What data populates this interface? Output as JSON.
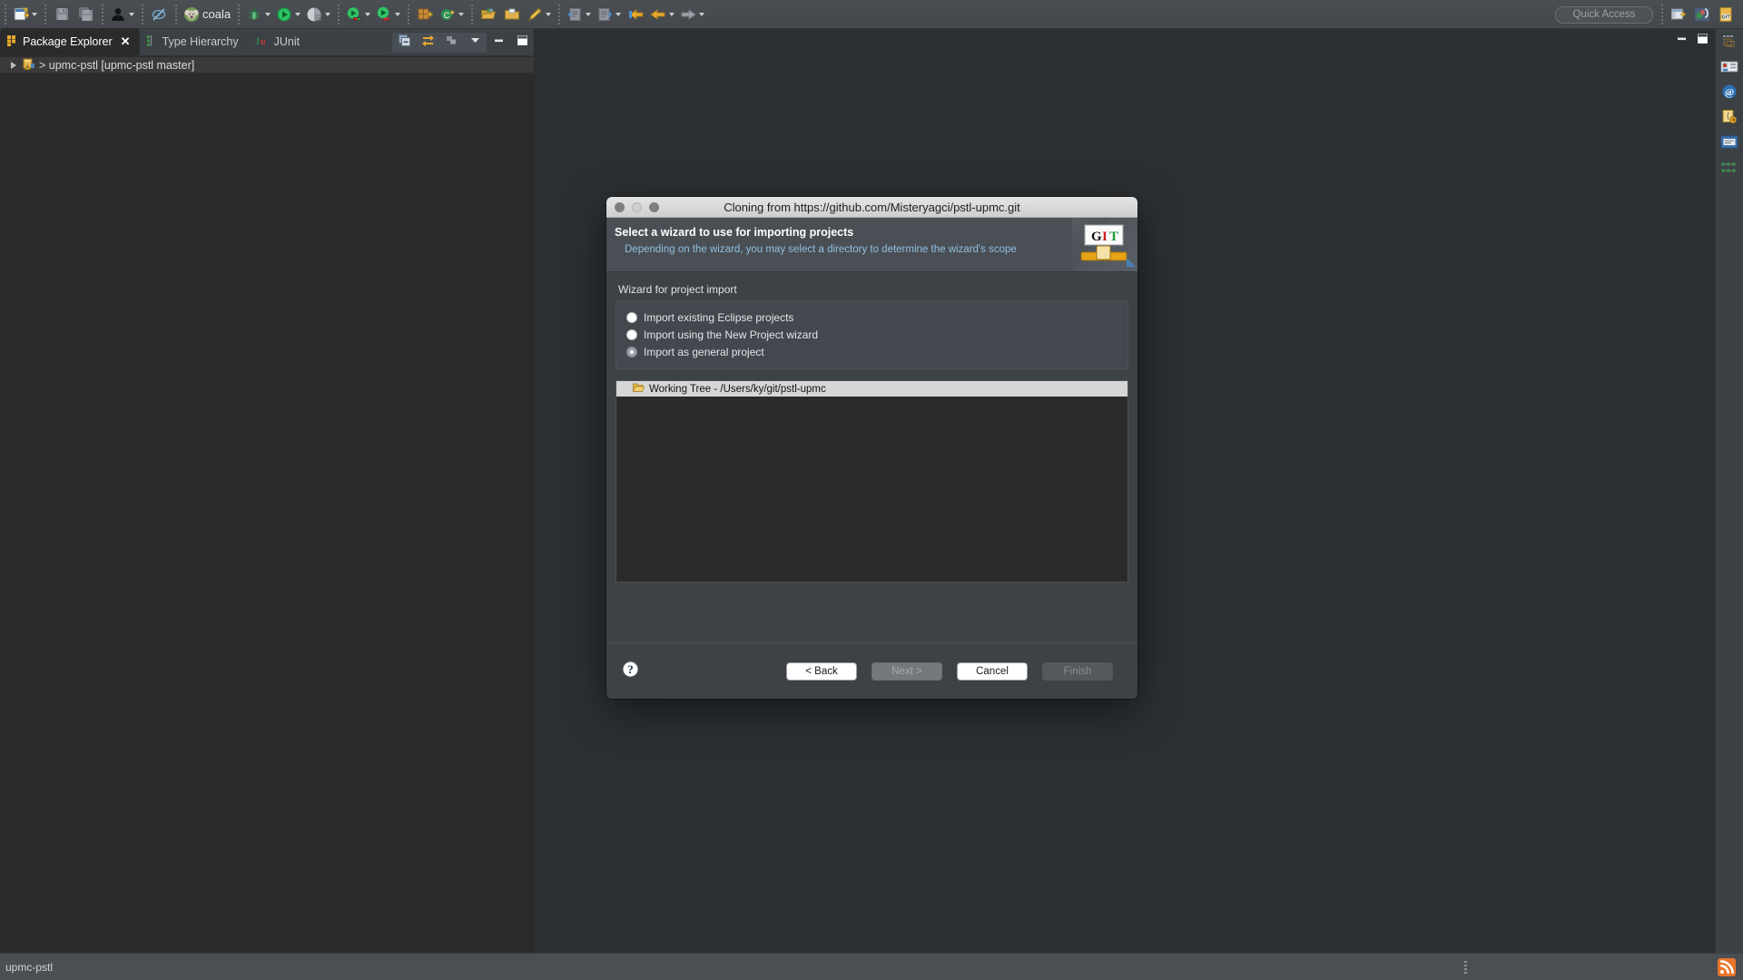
{
  "toolbar": {
    "items": [
      {
        "name": "new-wizard-button",
        "icon": "new-file-icon",
        "dropdown": true
      },
      {
        "name": "save-button",
        "icon": "save-disk-icon",
        "dropdown": false
      },
      {
        "name": "save-all-button",
        "icon": "save-all-icon",
        "dropdown": false
      },
      {
        "name": "person-button",
        "icon": "person-icon",
        "dropdown": true
      },
      {
        "name": "skip-breakpoints-button",
        "icon": "skip-breakpoints-icon",
        "dropdown": false
      },
      {
        "name": "coala-button",
        "icon": "coala-icon",
        "dropdown": false,
        "label": "coala"
      },
      {
        "name": "debug-button",
        "icon": "bug-icon",
        "dropdown": true
      },
      {
        "name": "run-button",
        "icon": "run-green-icon",
        "dropdown": true
      },
      {
        "name": "coverage-button",
        "icon": "coverage-icon",
        "dropdown": true
      },
      {
        "name": "run-external-tools-button",
        "icon": "run-tools-icon",
        "dropdown": true
      },
      {
        "name": "run-ant-button",
        "icon": "run-ant-icon",
        "dropdown": true
      },
      {
        "name": "new-java-package-button",
        "icon": "new-package-icon",
        "dropdown": false
      },
      {
        "name": "new-class-button",
        "icon": "new-class-icon",
        "dropdown": true
      },
      {
        "name": "open-type-button",
        "icon": "open-type-icon",
        "dropdown": false
      },
      {
        "name": "open-task-button",
        "icon": "open-folder-icon",
        "dropdown": false
      },
      {
        "name": "pencil-button",
        "icon": "pencil-icon",
        "dropdown": true
      },
      {
        "name": "previous-annotation-button",
        "icon": "prev-annotation-icon",
        "dropdown": true
      },
      {
        "name": "next-annotation-button",
        "icon": "next-annotation-icon",
        "dropdown": true
      },
      {
        "name": "last-edit-location-button",
        "icon": "last-edit-icon",
        "dropdown": false
      },
      {
        "name": "back-button",
        "icon": "arrow-left-icon",
        "dropdown": true
      },
      {
        "name": "forward-button",
        "icon": "arrow-right-icon",
        "dropdown": true
      }
    ],
    "coala_label": "coala",
    "quick_access_placeholder": "Quick Access",
    "perspective_buttons": [
      {
        "name": "open-perspective-button",
        "icon": "open-perspective-icon"
      },
      {
        "name": "java-perspective-button",
        "icon": "java-perspective-icon"
      },
      {
        "name": "git-perspective-button",
        "icon": "git-perspective-icon"
      }
    ]
  },
  "left_panel": {
    "tabs": [
      {
        "label": "Package Explorer",
        "icon": "package-explorer-icon",
        "active": true,
        "closable": true
      },
      {
        "label": "Type Hierarchy",
        "icon": "type-hierarchy-icon",
        "active": false,
        "closable": false
      },
      {
        "label": "JUnit",
        "icon": "junit-icon",
        "active": false,
        "closable": false
      }
    ],
    "close_label": "✕",
    "view_tools": [
      {
        "name": "collapse-all-button",
        "icon": "collapse-all-icon"
      },
      {
        "name": "link-with-editor-button",
        "icon": "link-editor-icon"
      },
      {
        "name": "focus-on-active-task-button",
        "icon": "focus-task-icon"
      },
      {
        "name": "view-menu-button",
        "icon": "chevron-down-icon"
      },
      {
        "name": "minimize-view-button",
        "icon": "minimize-icon"
      },
      {
        "name": "maximize-view-button",
        "icon": "maximize-icon"
      }
    ],
    "tree": [
      {
        "label": "> upmc-pstl [upmc-pstl master]",
        "icon": "java-project-warning-icon",
        "expandable": true,
        "selected": true
      }
    ]
  },
  "editor_area": {
    "controls": [
      {
        "name": "restore-editor-button",
        "icon": "minimize-icon"
      },
      {
        "name": "maximize-editor-button",
        "icon": "maximize-icon"
      }
    ]
  },
  "right_trim": {
    "items": [
      {
        "name": "restore-trim-button",
        "icon": "restore-icon"
      },
      {
        "name": "git-repositories-view-button",
        "icon": "git-repositories-icon"
      },
      {
        "name": "git-staging-view-button",
        "icon": "at-sign-icon"
      },
      {
        "name": "git-reflog-view-button",
        "icon": "reflog-icon"
      },
      {
        "name": "console-view-button",
        "icon": "console-icon"
      },
      {
        "name": "history-view-button",
        "icon": "history-graph-icon"
      }
    ]
  },
  "statusbar": {
    "text": "upmc-pstl",
    "rss_icon": "rss-icon"
  },
  "dialog": {
    "window_title": "Cloning from https://github.com/Misteryagci/pstl-upmc.git",
    "traffic_lights": [
      "close",
      "minimize",
      "maximize"
    ],
    "banner": {
      "title": "Select a wizard to use for importing projects",
      "subtitle": "Depending on the wizard, you may select a directory to determine the wizard's scope",
      "logo": {
        "name": "git-logo-icon",
        "letters": [
          {
            "char": "G",
            "color": "#111111"
          },
          {
            "char": "I",
            "color": "#cc1f1f"
          },
          {
            "char": "T",
            "color": "#1f9a3c"
          }
        ],
        "accent": "#e8a317"
      }
    },
    "group_label": "Wizard for project import",
    "radios": [
      {
        "label": "Import existing Eclipse projects",
        "selected": false
      },
      {
        "label": "Import using the New Project wizard",
        "selected": false
      },
      {
        "label": "Import as general project",
        "selected": true
      }
    ],
    "list": [
      {
        "label": "Working Tree - /Users/ky/git/pstl-upmc",
        "icon": "open-folder-icon",
        "selected": true
      }
    ],
    "help_button": {
      "name": "help-button",
      "icon": "question-mark-icon"
    },
    "buttons": [
      {
        "label": "< Back",
        "state": "enabled"
      },
      {
        "label": "Next >",
        "state": "disabled"
      },
      {
        "label": "Cancel",
        "state": "enabled"
      },
      {
        "label": "Finish",
        "state": "ghost"
      }
    ]
  },
  "colors": {
    "chrome": "#4a4f54",
    "panel": "#2b2b2b",
    "editor": "#2c3033",
    "dialog": "#3d4247",
    "accent_link": "#8fbfe0",
    "selection": "#d6d6d6",
    "git_orange": "#e8a317"
  }
}
